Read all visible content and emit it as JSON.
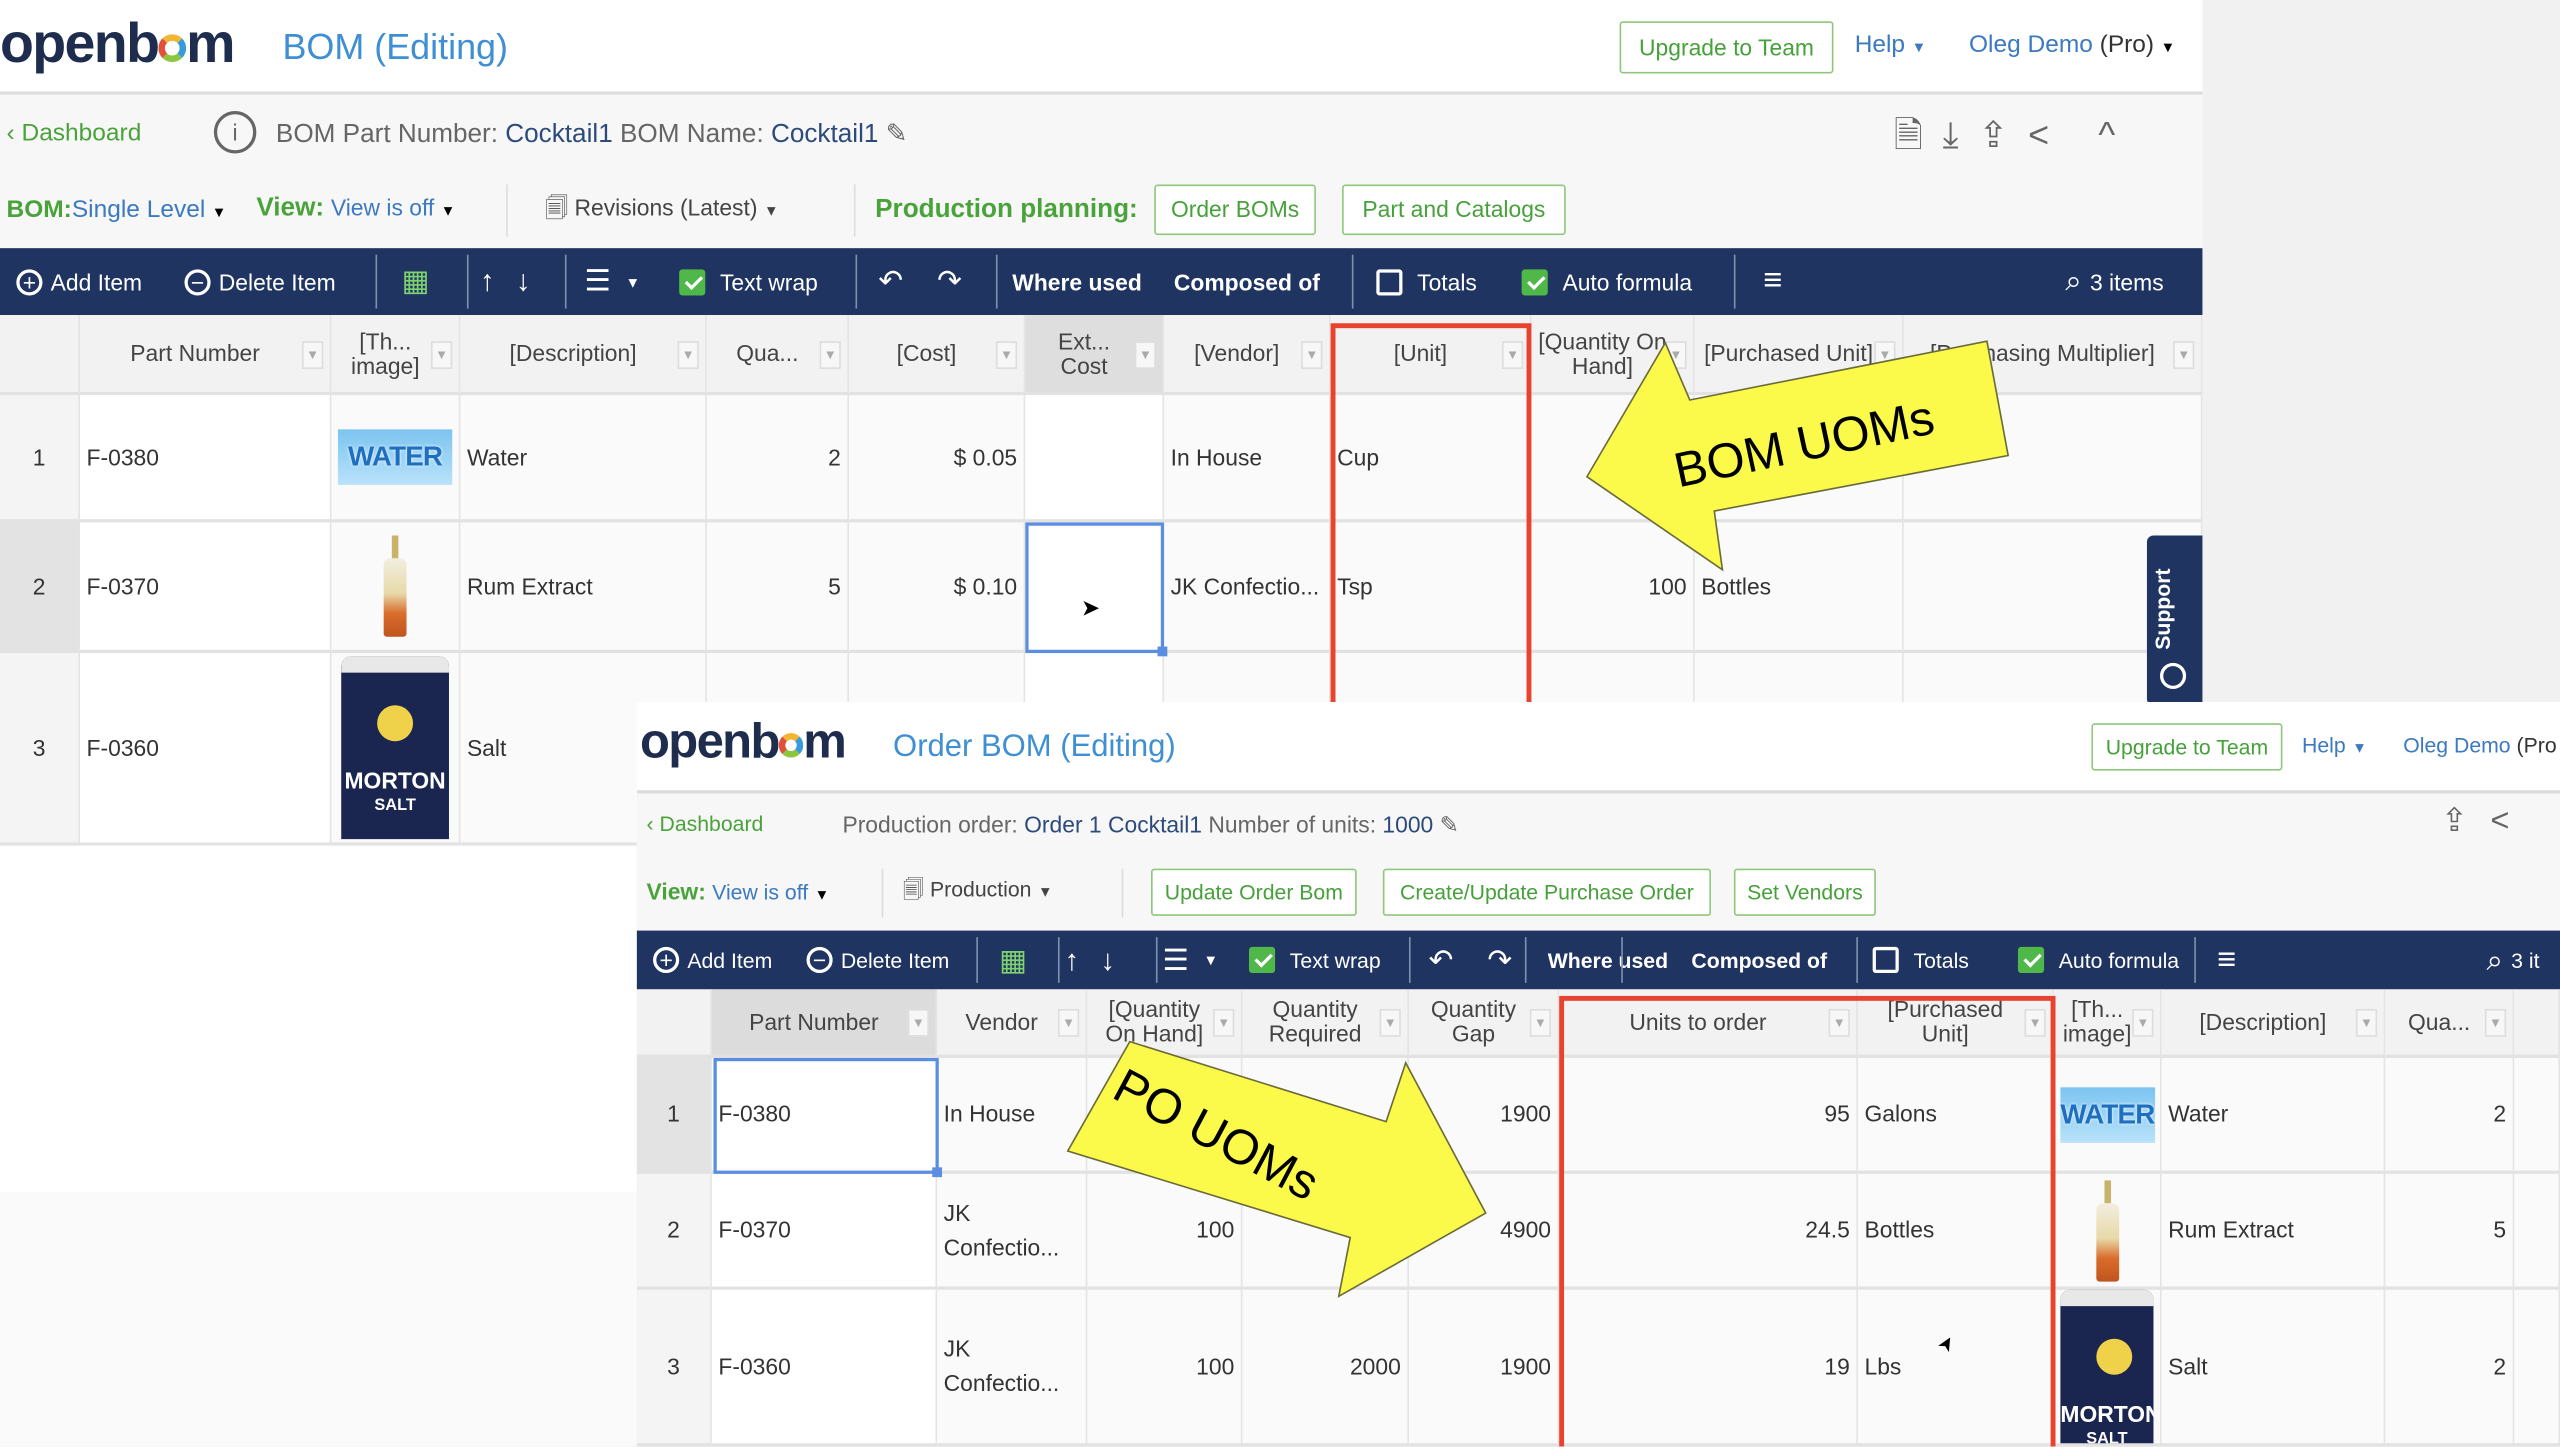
{
  "top": {
    "logo": "openbom",
    "title": "BOM (Editing)",
    "upgrade_label": "Upgrade to Team",
    "help_label": "Help",
    "user_name": "Oleg Demo",
    "user_plan": "(Pro)",
    "dashboard_label": "Dashboard",
    "part_number_label": "BOM Part Number:",
    "part_number": "Cocktail1",
    "bom_name_label": "BOM Name:",
    "bom_name": "Cocktail1",
    "bom_label": "BOM:",
    "bom_level": "Single Level",
    "view_label": "View:",
    "view_value": "View is off",
    "revisions_label": "Revisions (Latest)",
    "production_planning_label": "Production planning:",
    "order_boms_label": "Order BOMs",
    "part_catalogs_label": "Part and Catalogs",
    "support_label": "Support",
    "toolbar": {
      "add_item": "Add Item",
      "delete_item": "Delete Item",
      "text_wrap": "Text wrap",
      "text_wrap_checked": true,
      "where_used": "Where used",
      "composed_of": "Composed of",
      "totals": "Totals",
      "totals_checked": false,
      "auto_formula": "Auto formula",
      "auto_formula_checked": true,
      "items_count": "3 items"
    },
    "columns": [
      "",
      "Part Number",
      "[Th... image]",
      "[Description]",
      "Qua...",
      "[Cost]",
      "Ext... Cost",
      "[Vendor]",
      "[Unit]",
      "[Quantity On Hand]",
      "[Purchased Unit]",
      "[Purchasing Multiplier]"
    ],
    "rows": [
      {
        "cells": [
          "1",
          "F-0380",
          "",
          "Water",
          "2",
          "$ 0.05",
          "",
          "In House",
          "Cup",
          "",
          "",
          ""
        ],
        "image": {
          "kind": "water",
          "label": "WATER"
        }
      },
      {
        "cells": [
          "2",
          "F-0370",
          "",
          "Rum Extract",
          "5",
          "$ 0.10",
          "",
          "JK Confectio...",
          "Tsp",
          "100",
          "Bottles",
          ""
        ],
        "image": {
          "kind": "rum",
          "label": ""
        }
      },
      {
        "cells": [
          "3",
          "F-0360",
          "",
          "Salt",
          "",
          "",
          "",
          "",
          "",
          "",
          "",
          ""
        ],
        "image": {
          "kind": "salt",
          "label": "MORTON SALT"
        }
      }
    ],
    "callout": "BOM UOMs"
  },
  "bottom": {
    "logo": "openbom",
    "title": "Order BOM (Editing)",
    "upgrade_label": "Upgrade to Team",
    "help_label": "Help",
    "user_name": "Oleg Demo",
    "user_plan": "(Pro",
    "dashboard_label": "Dashboard",
    "production_order_label": "Production order:",
    "production_order": "Order 1 Cocktail1",
    "units_label": "Number of units:",
    "units": "1000",
    "view_label": "View:",
    "view_value": "View is off",
    "production_label": "Production",
    "update_order_label": "Update Order Bom",
    "create_po_label": "Create/Update Purchase Order",
    "set_vendors_label": "Set Vendors",
    "toolbar": {
      "add_item": "Add Item",
      "delete_item": "Delete Item",
      "text_wrap": "Text wrap",
      "text_wrap_checked": true,
      "where_used": "Where used",
      "composed_of": "Composed of",
      "totals": "Totals",
      "totals_checked": false,
      "auto_formula": "Auto formula",
      "auto_formula_checked": true,
      "items_count": "3 it"
    },
    "columns": [
      "",
      "Part Number",
      "Vendor",
      "[Quantity On Hand]",
      "Quantity Required",
      "Quantity Gap",
      "Units to order",
      "[Purchased Unit]",
      "[Th... image]",
      "[Description]",
      "Qua...",
      ""
    ],
    "rows": [
      {
        "cells": [
          "1",
          "F-0380",
          "In House",
          "",
          "",
          "1900",
          "95",
          "Galons",
          "",
          "Water",
          "2",
          ""
        ],
        "image": {
          "kind": "water",
          "label": "WATER"
        }
      },
      {
        "cells": [
          "2",
          "F-0370",
          "JK Confectio...",
          "100",
          "",
          "4900",
          "24.5",
          "Bottles",
          "",
          "Rum Extract",
          "5",
          ""
        ],
        "image": {
          "kind": "rum",
          "label": ""
        }
      },
      {
        "cells": [
          "3",
          "F-0360",
          "JK Confectio...",
          "100",
          "2000",
          "1900",
          "19",
          "Lbs",
          "",
          "Salt",
          "2",
          ""
        ],
        "image": {
          "kind": "salt",
          "label": "MORTON SALT"
        }
      }
    ],
    "callout": "PO UOMs"
  },
  "colors": {
    "toolbar_bg": "#1f3461",
    "accent_green": "#4aa33a",
    "link_blue": "#3b79c0",
    "highlight_red": "#e8432e",
    "callout_yellow": "#fbf94a"
  }
}
